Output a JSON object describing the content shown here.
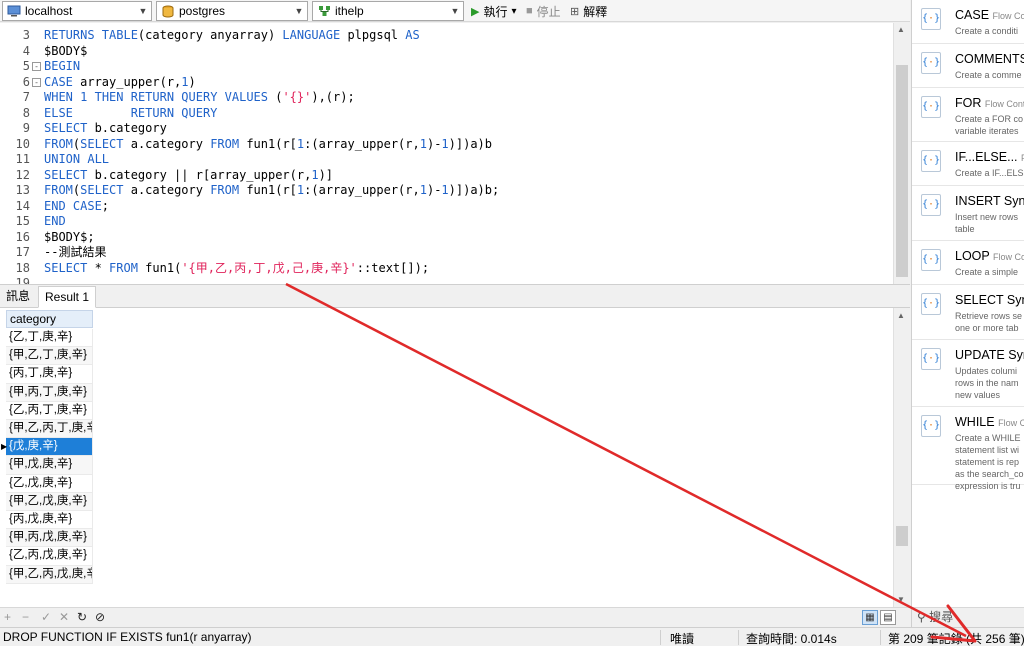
{
  "toolbar": {
    "connection": "localhost",
    "database": "postgres",
    "schema": "ithelp",
    "run_label": "執行",
    "run_dropdown": "▾",
    "stop_label": "停止",
    "explain_label": "解釋"
  },
  "editor": {
    "lines": [
      {
        "n": "3",
        "fold": "",
        "html": "<span class='kw'>RETURNS TABLE</span>(category anyarray) <span class='kw'>LANGUAGE</span> plpgsql <span class='kw'>AS</span>"
      },
      {
        "n": "4",
        "fold": "",
        "html": "$BODY$"
      },
      {
        "n": "5",
        "fold": "-",
        "html": "<span class='kw'>BEGIN</span>"
      },
      {
        "n": "6",
        "fold": "-",
        "html": "<span class='kw'>CASE</span> array_upper(r,<span class='num'>1</span>)"
      },
      {
        "n": "7",
        "fold": "",
        "html": "<span class='kw'>WHEN</span> <span class='num'>1</span> <span class='kw'>THEN RETURN QUERY VALUES</span> (<span class='str'>'{}'</span>),(r);"
      },
      {
        "n": "8",
        "fold": "",
        "html": "<span class='kw'>ELSE</span>        <span class='kw'>RETURN QUERY</span>"
      },
      {
        "n": "9",
        "fold": "",
        "html": "<span class='kw'>SELECT</span> b.category"
      },
      {
        "n": "10",
        "fold": "",
        "html": "<span class='kw'>FROM</span>(<span class='kw'>SELECT</span> a.category <span class='kw'>FROM</span> fun1(r[<span class='num'>1</span>:(array_upper(r,<span class='num'>1</span>)-<span class='num'>1</span>)])a)b"
      },
      {
        "n": "11",
        "fold": "",
        "html": "<span class='kw'>UNION ALL</span>"
      },
      {
        "n": "12",
        "fold": "",
        "html": "<span class='kw'>SELECT</span> b.category || r[array_upper(r,<span class='num'>1</span>)]"
      },
      {
        "n": "13",
        "fold": "",
        "html": "<span class='kw'>FROM</span>(<span class='kw'>SELECT</span> a.category <span class='kw'>FROM</span> fun1(r[<span class='num'>1</span>:(array_upper(r,<span class='num'>1</span>)-<span class='num'>1</span>)])a)b;"
      },
      {
        "n": "14",
        "fold": "",
        "html": "<span class='kw'>END CASE</span>;"
      },
      {
        "n": "15",
        "fold": "",
        "html": "<span class='kw'>END</span>"
      },
      {
        "n": "16",
        "fold": "",
        "html": "$BODY$;"
      },
      {
        "n": "17",
        "fold": "",
        "html": "--測試結果"
      },
      {
        "n": "18",
        "fold": "",
        "html": "<span class='kw'>SELECT</span> * <span class='kw'>FROM</span> fun1(<span class='str'>'{甲,乙,丙,丁,戊,己,庚,辛}'</span>::text[]);"
      },
      {
        "n": "19",
        "fold": "",
        "html": ""
      }
    ]
  },
  "tabs": [
    {
      "label": "訊息",
      "active": false
    },
    {
      "label": "Result 1",
      "active": true
    }
  ],
  "grid": {
    "column": "category",
    "rows": [
      "{乙,丁,庚,辛}",
      "{甲,乙,丁,庚,辛}",
      "{丙,丁,庚,辛}",
      "{甲,丙,丁,庚,辛}",
      "{乙,丙,丁,庚,辛}",
      "{甲,乙,丙,丁,庚,辛}",
      "{戊,庚,辛}",
      "{甲,戊,庚,辛}",
      "{乙,戊,庚,辛}",
      "{甲,乙,戊,庚,辛}",
      "{丙,戊,庚,辛}",
      "{甲,丙,戊,庚,辛}",
      "{乙,丙,戊,庚,辛}",
      "{甲,乙,丙,戊,庚,辛}"
    ],
    "selected_index": 6
  },
  "gridbar": {
    "add": "+",
    "remove": "−",
    "apply": "✓",
    "discard": "✕",
    "refresh": "↻",
    "stop": "⊘"
  },
  "status": {
    "sql": "DROP FUNCTION IF EXISTS    fun1(r anyarray)",
    "mode": "唯讀",
    "query_time": "查詢時間: 0.014s",
    "records": "第 209 筆記錄 (共 256 筆)"
  },
  "snippets": [
    {
      "title": "CASE",
      "tag": "Flow Cor",
      "desc": "Create a conditi"
    },
    {
      "title": "COMMENTS",
      "tag": "",
      "desc": "Create a comme"
    },
    {
      "title": "FOR",
      "tag": "Flow Cont",
      "desc": "Create a FOR co\nvariable iterates"
    },
    {
      "title": "IF...ELSE...",
      "tag": "Flo",
      "desc": "Create a IF...ELS"
    },
    {
      "title": "INSERT Synt",
      "tag": "",
      "desc": "Insert new rows\ntable"
    },
    {
      "title": "LOOP",
      "tag": "Flow Co",
      "desc": "Create a simple"
    },
    {
      "title": "SELECT Synt",
      "tag": "",
      "desc": "Retrieve rows se\none or more tab"
    },
    {
      "title": "UPDATE Syn",
      "tag": "",
      "desc": "Updates columi\nrows in the nam\nnew values"
    },
    {
      "title": "WHILE",
      "tag": "Flow C",
      "desc": "Create a WHILE\nstatement list wi\nstatement is rep\nas the search_co\nexpression is tru"
    }
  ],
  "search": {
    "placeholder": "搜尋"
  },
  "colors": {
    "keyword": "#1f62c9",
    "string": "#e0225a",
    "selection": "#1e7fd8",
    "arrow": "#e02a2a"
  }
}
